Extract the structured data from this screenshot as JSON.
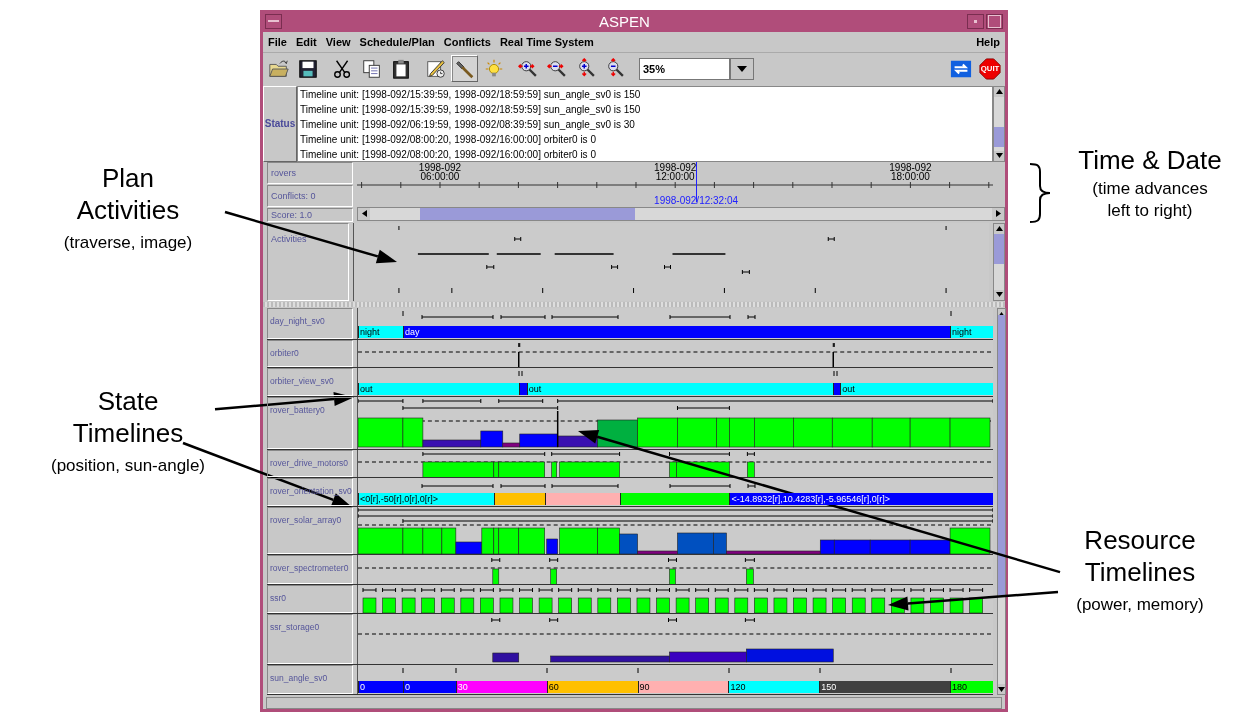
{
  "window": {
    "title": "ASPEN"
  },
  "menu": [
    {
      "label": "File"
    },
    {
      "label": "Edit"
    },
    {
      "label": "View"
    },
    {
      "label": "Schedule/Plan"
    },
    {
      "label": "Conflicts"
    },
    {
      "label": "Real Time System"
    }
  ],
  "help_menu": {
    "label": "Help"
  },
  "toolbar_groups": [
    {
      "tools": [
        {
          "kind": "open",
          "pressed": false
        },
        {
          "kind": "save",
          "pressed": false
        }
      ]
    },
    {
      "tools": [
        {
          "kind": "cut",
          "pressed": false
        },
        {
          "kind": "copy",
          "pressed": false
        },
        {
          "kind": "paste",
          "pressed": false
        }
      ]
    },
    {
      "tools": [
        {
          "kind": "edit",
          "pressed": false
        },
        {
          "kind": "hammer",
          "pressed": true
        },
        {
          "kind": "bulb",
          "pressed": false
        }
      ]
    },
    {
      "tools": [
        {
          "kind": "zoom_in_h",
          "pressed": false
        },
        {
          "kind": "zoom_out_h",
          "pressed": false
        },
        {
          "kind": "zoom_in_v",
          "pressed": false
        },
        {
          "kind": "zoom_out_v",
          "pressed": false
        }
      ]
    }
  ],
  "zoom_field": {
    "value": "35%"
  },
  "right_tools": [
    {
      "kind": "refresh",
      "pressed": false
    },
    {
      "kind": "quit",
      "label": "QUIT",
      "pressed": false
    }
  ],
  "status": {
    "label": "Status",
    "lines": [
      "Timeline unit: [1998-092/15:39:59, 1998-092/18:59:59] sun_angle_sv0 is 150",
      "Timeline unit: [1998-092/15:39:59, 1998-092/18:59:59] sun_angle_sv0 is 150",
      "Timeline unit: [1998-092/06:19:59, 1998-092/08:39:59] sun_angle_sv0 is 30",
      "Timeline unit: [1998-092/08:00:20, 1998-092/16:00:00] orbiter0 is 0",
      "Timeline unit: [1998-092/08:00:20, 1998-092/16:00:00] orbiter0 is 0"
    ]
  },
  "header": {
    "labels": [
      "rovers",
      "Conflicts: 0",
      "Score: 1.0"
    ],
    "ticks": [
      {
        "date": "1998-092",
        "time": "06:00:00"
      },
      {
        "date": "1998-092",
        "time": "12:00:00"
      },
      {
        "date": "1998-092",
        "time": "18:00:00"
      }
    ],
    "cursor": {
      "label": "1998-092/12:32:04"
    }
  },
  "activities": {
    "label": "Activities"
  },
  "timelines": [
    {
      "name": "day_night_sv0",
      "kind": "state",
      "segments": [
        {
          "label": "night",
          "color": "#00ffff"
        },
        {
          "label": "day",
          "color": "#0000ff"
        },
        {
          "label": "night",
          "color": "#00ffff"
        }
      ]
    },
    {
      "name": "orbiter0",
      "kind": "resource"
    },
    {
      "name": "orbiter_view_sv0",
      "kind": "state",
      "segments": [
        {
          "label": "out",
          "color": "#00ffff"
        },
        {
          "color": "#0000ff"
        },
        {
          "label": "out",
          "color": "#00ffff"
        },
        {
          "color": "#0000ff"
        },
        {
          "label": "out",
          "color": "#00ffff"
        }
      ]
    },
    {
      "name": "rover_battery0",
      "kind": "resource"
    },
    {
      "name": "rover_drive_motors0",
      "kind": "resource"
    },
    {
      "name": "rover_orientation_sv0",
      "kind": "state",
      "segments": [
        {
          "label": "<0[r],-50[r],0[r],0[r]>",
          "color": "#00ffff"
        },
        {
          "color": "#ffc000"
        },
        {
          "color": "#ffb0b0"
        },
        {
          "color": "#00ff00"
        },
        {
          "label": "<-14.8932[r],10.4283[r],-5.96546[r],0[r]>",
          "color": "#0000ff"
        }
      ]
    },
    {
      "name": "rover_solar_array0",
      "kind": "resource"
    },
    {
      "name": "rover_spectrometer0",
      "kind": "resource"
    },
    {
      "name": "ssr0",
      "kind": "resource"
    },
    {
      "name": "ssr_storage0",
      "kind": "resource"
    },
    {
      "name": "sun_angle_sv0",
      "kind": "state",
      "segments": [
        {
          "label": "0",
          "color": "#0000ff"
        },
        {
          "label": "0",
          "color": "#0000ff"
        },
        {
          "label": "30",
          "color": "#ff00ff"
        },
        {
          "label": "60",
          "color": "#ffc000"
        },
        {
          "label": "90",
          "color": "#ffb0b0"
        },
        {
          "label": "120",
          "color": "#00ffff"
        },
        {
          "label": "150",
          "color": "#404040"
        },
        {
          "label": "180",
          "color": "#00ff00"
        }
      ]
    }
  ],
  "annotations": [
    {
      "kind": "callout",
      "heading": "Plan\nActivities",
      "note": "(traverse, image)"
    },
    {
      "kind": "brace",
      "heading": "Time & Date",
      "note": "(time advances\nleft to right)"
    },
    {
      "kind": "callout",
      "heading": "State\nTimelines",
      "note": "(position, sun-angle)"
    },
    {
      "kind": "callout",
      "heading": "Resource\nTimelines",
      "note": "(power, memory)"
    }
  ]
}
